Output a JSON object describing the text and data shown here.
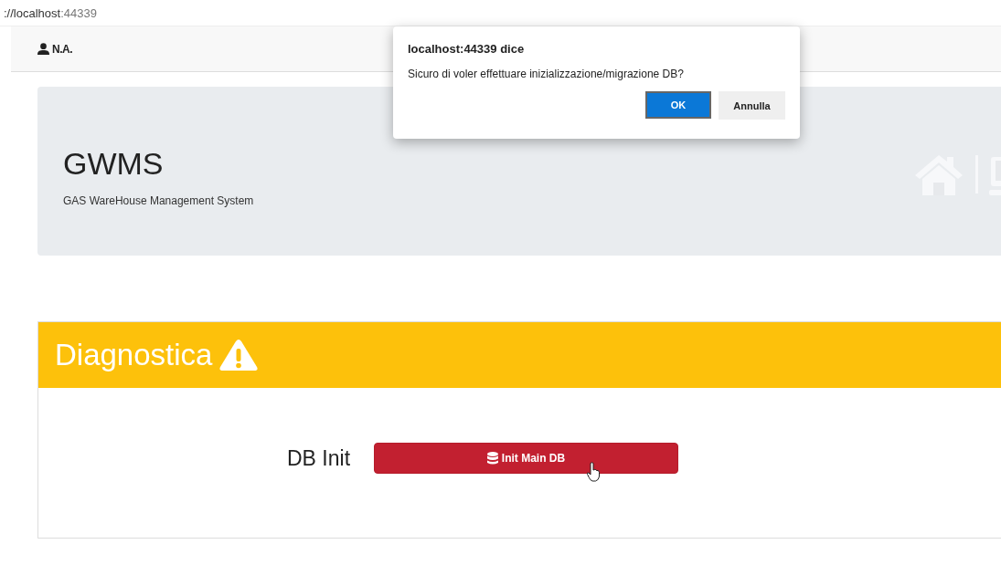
{
  "address_bar": {
    "host": "://localhost",
    "port": ":44339"
  },
  "navbar": {
    "user": "N.A."
  },
  "header": {
    "title": "GWMS",
    "subtitle": "GAS WareHouse Management System"
  },
  "card": {
    "title": "Diagnostica",
    "row_label": "DB Init",
    "button": "Init Main DB"
  },
  "dialog": {
    "title": "localhost:44339 dice",
    "message": "Sicuro di voler effettuare inizializzazione/migrazione DB?",
    "buttons": [
      {
        "label": "OK",
        "selected": true
      },
      {
        "label": "Annulla",
        "selected": false
      }
    ]
  }
}
